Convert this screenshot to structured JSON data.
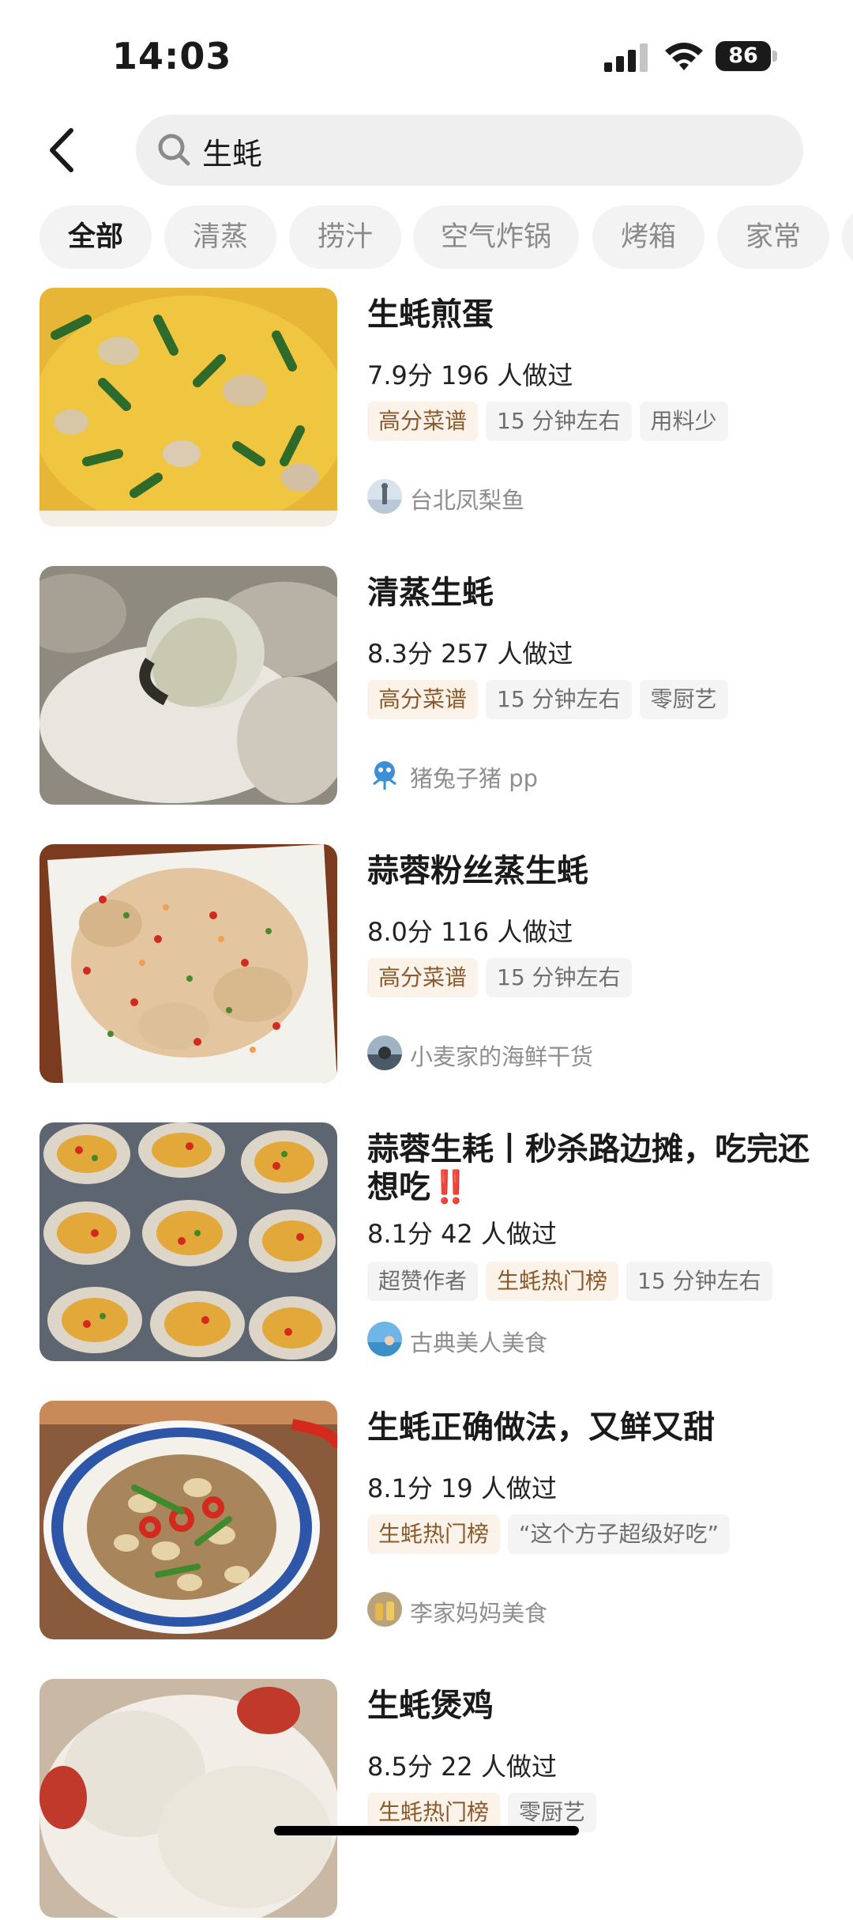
{
  "status_bar": {
    "time": "14:03",
    "battery": "86"
  },
  "search": {
    "query": "生蚝"
  },
  "chips": [
    "全部",
    "清蒸",
    "捞汁",
    "空气炸锅",
    "烤箱",
    "家常"
  ],
  "recipes": [
    {
      "title": "生蚝煎蛋",
      "meta": "7.9分 196 人做过",
      "tags": [
        "高分菜谱",
        "15 分钟左右",
        "用料少"
      ],
      "author": "台北凤梨鱼"
    },
    {
      "title": "清蒸生蚝",
      "meta": "8.3分 257 人做过",
      "tags": [
        "高分菜谱",
        "15 分钟左右",
        "零厨艺"
      ],
      "author": "猪兔子猪 pp"
    },
    {
      "title": "蒜蓉粉丝蒸生蚝",
      "meta": "8.0分 116 人做过",
      "tags": [
        "高分菜谱",
        "15 分钟左右"
      ],
      "author": "小麦家的海鲜干货"
    },
    {
      "title": "蒜蓉生耗丨秒杀路边摊，吃完还想吃‼️",
      "meta": "8.1分 42 人做过",
      "tags": [
        "超赞作者",
        "生蚝热门榜",
        "15 分钟左右"
      ],
      "author": "古典美人美食"
    },
    {
      "title": "生蚝正确做法，又鲜又甜",
      "meta": "8.1分 19 人做过",
      "tags": [
        "生蚝热门榜",
        "“这个方子超级好吃”"
      ],
      "author": "李家妈妈美食"
    },
    {
      "title": "生蚝煲鸡",
      "meta": "8.5分 22 人做过",
      "tags": [
        "生蚝热门榜",
        "零厨艺"
      ]
    }
  ]
}
